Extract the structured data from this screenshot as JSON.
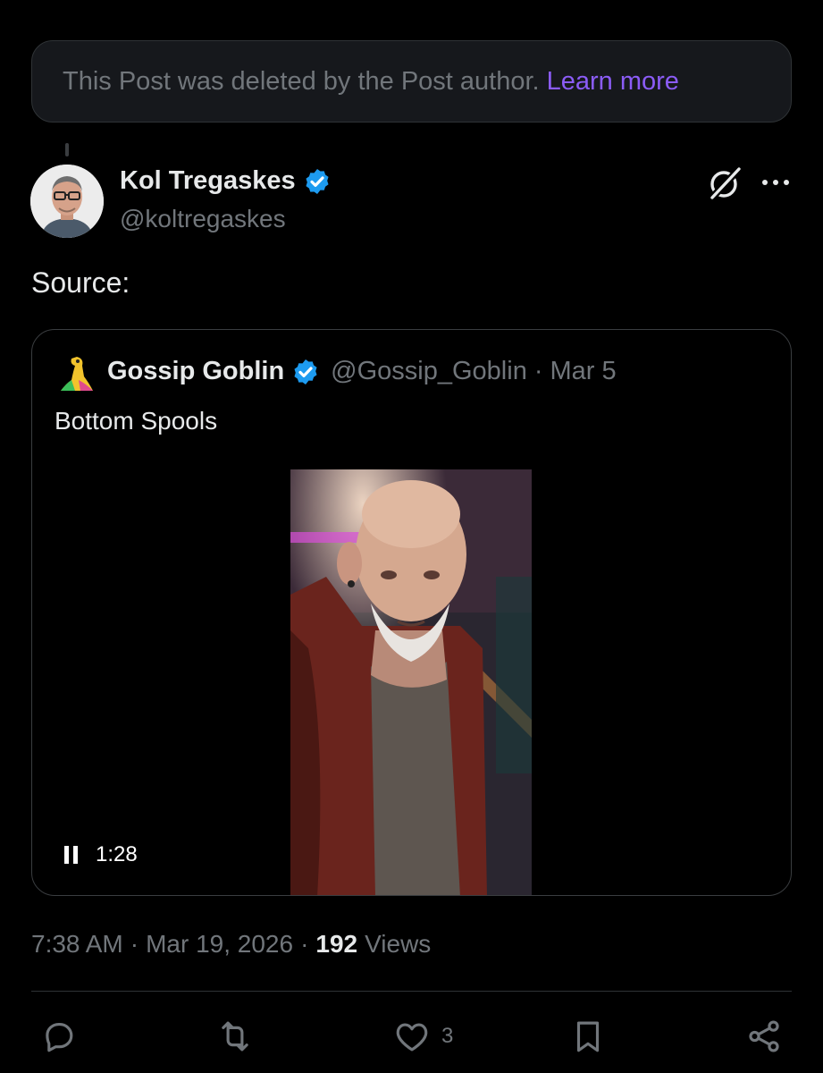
{
  "deleted_notice": {
    "text": "This Post was deleted by the Post author.",
    "link": "Learn more",
    "link_color": "#8b5cf6"
  },
  "post": {
    "author_name": "Kol Tregaskes",
    "author_handle": "@koltregaskes",
    "verified": true,
    "text": "Source:",
    "time": "7:38 AM",
    "date": "Mar 19, 2026",
    "views_count": "192",
    "views_label": "Views",
    "likes": "3"
  },
  "quoted_post": {
    "author_name": "Gossip Goblin",
    "author_handle": "@Gossip_Goblin",
    "verified": true,
    "separator": "·",
    "date": "Mar 5",
    "text": "Bottom Spools",
    "video_time": "1:28"
  },
  "colors": {
    "background": "#000000",
    "text_primary": "#e7e9ea",
    "text_secondary": "#71767b",
    "verified_blue": "#1d9bf0",
    "border": "#2f3336"
  },
  "icons": [
    "grok-icon",
    "more-icon",
    "verified-icon",
    "pause-icon",
    "reply-icon",
    "retweet-icon",
    "like-icon",
    "bookmark-icon",
    "share-icon"
  ]
}
